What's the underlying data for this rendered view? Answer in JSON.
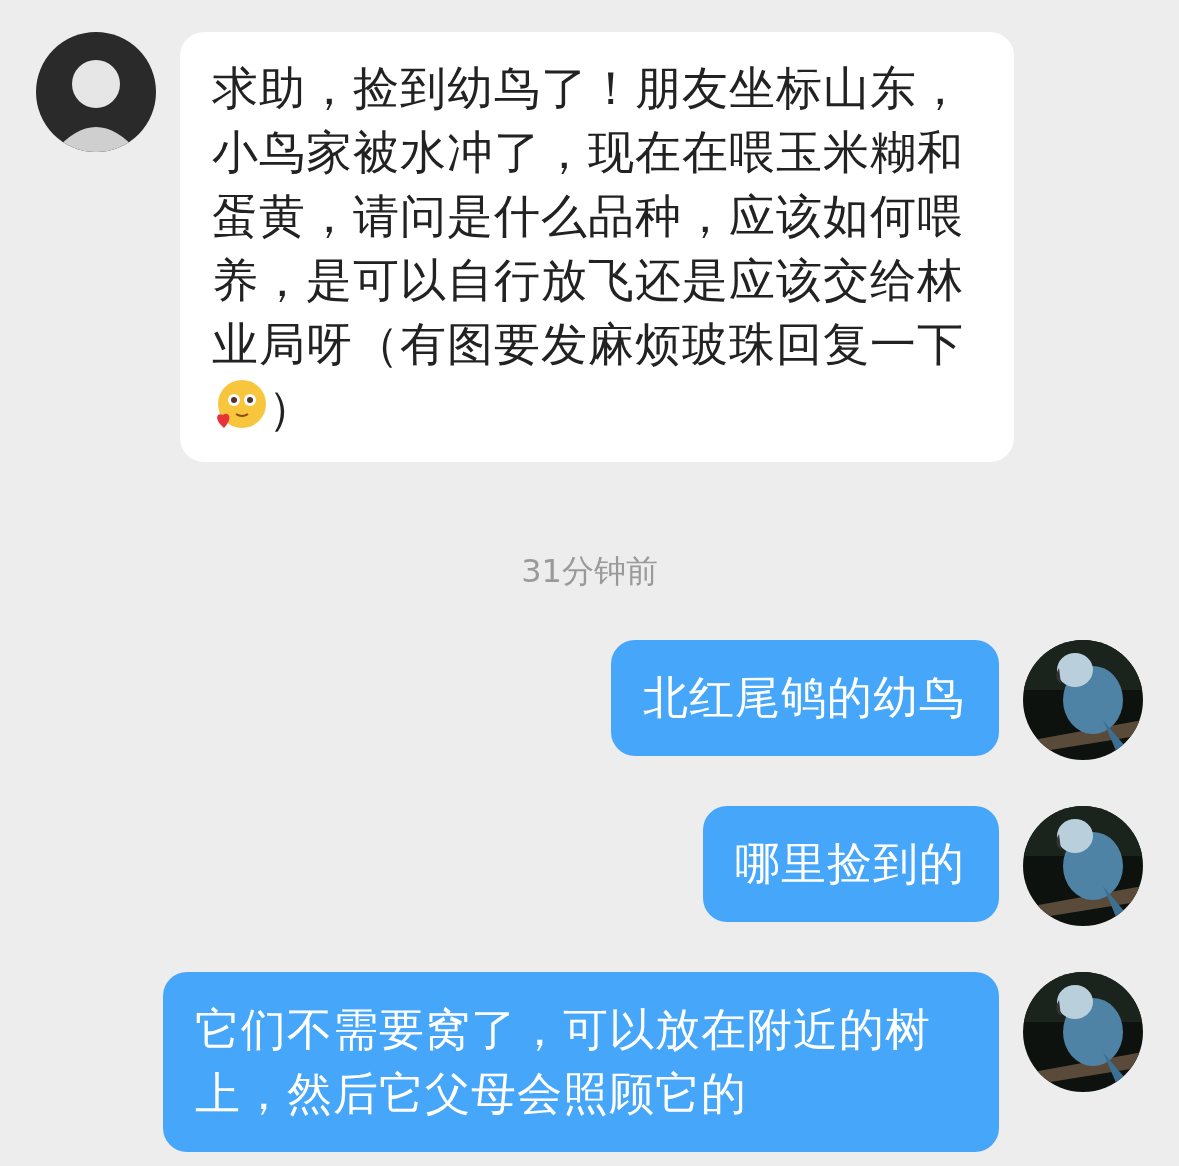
{
  "messages": [
    {
      "kind": "incoming",
      "segments": [
        {
          "kind": "text",
          "text": "求助，捡到幼鸟了！朋友坐标山东，小鸟家被水冲了，现在在喂玉米糊和蛋黄，请问是什么品种，应该如何喂养，是可以自行放飞还是应该交给林业局呀（有图要发麻烦玻珠回复一下"
        },
        {
          "kind": "emoji"
        },
        {
          "kind": "text",
          "text": "）"
        }
      ]
    },
    {
      "kind": "timestamp",
      "text": "31分钟前"
    },
    {
      "kind": "outgoing",
      "segments": [
        {
          "kind": "text",
          "text": "北红尾鸲的幼鸟"
        }
      ]
    },
    {
      "kind": "outgoing",
      "segments": [
        {
          "kind": "text",
          "text": "哪里捡到的"
        }
      ]
    },
    {
      "kind": "outgoing",
      "segments": [
        {
          "kind": "text",
          "text": "它们不需要窝了，可以放在附近的树上，然后它父母会照顾它的"
        }
      ]
    }
  ]
}
